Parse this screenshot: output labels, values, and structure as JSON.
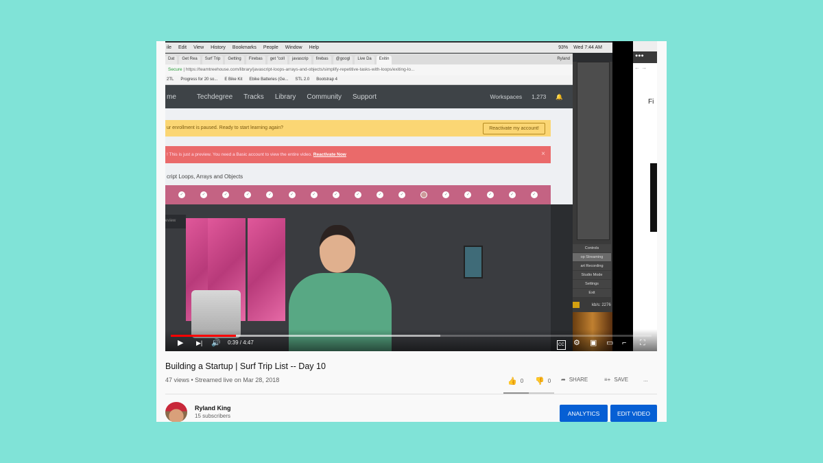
{
  "menubar": {
    "items": [
      "ile",
      "Edit",
      "View",
      "History",
      "Bookmarks",
      "People",
      "Window",
      "Help"
    ],
    "battery": "93%",
    "clock": "Wed 7:44 AM"
  },
  "tabs": [
    "Dat",
    "Get Rea",
    "Surf Trip",
    "Getting",
    "Firebas",
    "get \"coll",
    "javascrip",
    "firebas",
    "@googl",
    "Live Da",
    "Exitin"
  ],
  "profile_name": "Ryland",
  "address": {
    "secure": "Secure",
    "url": "https://teamtreehouse.com/library/javascript-loops-arrays-and-objects/simplify-repetitive-tasks-with-loops/exiting-lo..."
  },
  "bookmarks": [
    "2TL",
    "Progress for 20 so...",
    "E Bike Kit",
    "Ebike Batteries (Ge...",
    "STL 2.0",
    "Bootstrap 4"
  ],
  "treehouse": {
    "nav": [
      "me",
      "Techdegree",
      "Tracks",
      "Library",
      "Community",
      "Support"
    ],
    "workspaces": "Workspaces",
    "points": "1,273",
    "yellow_banner": "ur enrollment is paused. Ready to start learning again?",
    "reactivate_button": "Reactivate my account!",
    "red_banner": "! This is just a preview. You need a Basic account to view the entire video.",
    "reactivate_now": "Reactivate Now",
    "close": "×",
    "course_title": "cript Loops, Arrays and Objects",
    "preview_label": "eview"
  },
  "obs": {
    "menu": [
      "Controls",
      "op Streaming",
      "art Recording",
      "Studio Mode",
      "Settings",
      "Exit"
    ],
    "kbps": "kb/s: 2276",
    "right_text": "Fi"
  },
  "player": {
    "time": "0:39 / 4:47",
    "played_fraction": 0.136,
    "buffered_fraction": 0.56,
    "progress_color": "#ff0000"
  },
  "video": {
    "title": "Building a Startup | Surf Trip List -- Day 10",
    "meta": "47 views • Streamed live on Mar 28, 2018",
    "likes": "0",
    "dislikes": "0",
    "share": "SHARE",
    "save": "SAVE",
    "more": "..."
  },
  "channel": {
    "name": "Ryland King",
    "subscribers": "15 subscribers"
  },
  "buttons": {
    "analytics": "ANALYTICS",
    "edit_video": "EDIT VIDEO"
  },
  "colors": {
    "background": "#80e3d7",
    "button_blue": "#065fd4"
  }
}
